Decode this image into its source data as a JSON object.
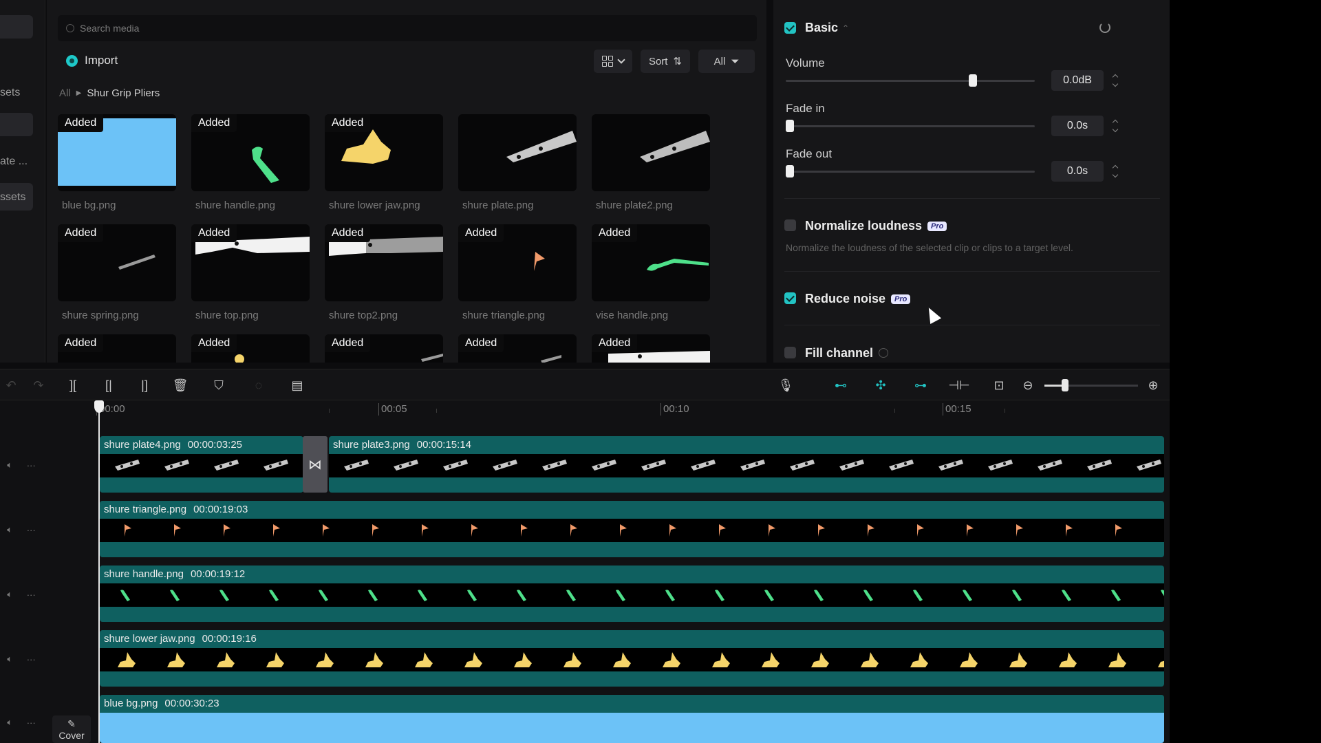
{
  "left_strip": {
    "items": [
      {
        "label": "sets"
      },
      {
        "label": "ate ..."
      },
      {
        "label": "ssets"
      }
    ]
  },
  "media": {
    "search_placeholder": "Search media",
    "import_label": "Import",
    "sort_label": "Sort",
    "filter_label": "All",
    "breadcrumb": {
      "root": "All",
      "current": "Shur Grip Pliers"
    },
    "tiles": [
      {
        "status": "Added",
        "name": "blue bg.png"
      },
      {
        "status": "Added",
        "name": "shure handle.png"
      },
      {
        "status": "Added",
        "name": "shure lower jaw.png"
      },
      {
        "status": "Added",
        "name": "shure plate.png"
      },
      {
        "status": "Added",
        "name": "shure plate2.png"
      },
      {
        "status": "Added",
        "name": "shure spring.png"
      },
      {
        "status": "Added",
        "name": "shure top.png"
      },
      {
        "status": "Added",
        "name": "shure top2.png"
      },
      {
        "status": "Added",
        "name": "shure triangle.png"
      },
      {
        "status": "Added",
        "name": "vise handle.png"
      },
      {
        "status": "Added",
        "name": ""
      },
      {
        "status": "Added",
        "name": ""
      },
      {
        "status": "Added",
        "name": ""
      },
      {
        "status": "Added",
        "name": ""
      },
      {
        "status": "Added",
        "name": ""
      }
    ]
  },
  "props": {
    "basic": {
      "title": "Basic",
      "checked": true
    },
    "volume": {
      "label": "Volume",
      "value": "0.0dB",
      "level": 0.75
    },
    "fade_in": {
      "label": "Fade in",
      "value": "0.0s",
      "level": 0
    },
    "fade_out": {
      "label": "Fade out",
      "value": "0.0s",
      "level": 0
    },
    "normalize": {
      "label": "Normalize loudness",
      "badge": "Pro",
      "checked": false,
      "description": "Normalize the loudness of the selected clip or clips to a target level."
    },
    "reduce_noise": {
      "label": "Reduce noise",
      "badge": "Pro",
      "checked": true
    },
    "fill_channel": {
      "label": "Fill channel",
      "checked": false
    }
  },
  "timeline": {
    "ruler": [
      "00:00",
      "00:05",
      "00:10",
      "00:15"
    ],
    "tracks": [
      {
        "clips": [
          {
            "name": "shure plate4.png",
            "duration": "00:00:03:25"
          },
          {
            "name": "shure plate3.png",
            "duration": "00:00:15:14"
          }
        ]
      },
      {
        "clips": [
          {
            "name": "shure triangle.png",
            "duration": "00:00:19:03"
          }
        ]
      },
      {
        "clips": [
          {
            "name": "shure handle.png",
            "duration": "00:00:19:12"
          }
        ]
      },
      {
        "clips": [
          {
            "name": "shure lower jaw.png",
            "duration": "00:00:19:16"
          }
        ]
      },
      {
        "clips": [
          {
            "name": "blue bg.png",
            "duration": "00:00:30:23"
          }
        ]
      }
    ],
    "cover_label": "Cover",
    "zoom_level": 0.22
  },
  "colors": {
    "accent": "#22c3c3",
    "clip_teal": "#0f6060",
    "bg_blue": "#6cc2f7",
    "triangle": "#f19a6a",
    "handle": "#4ee08a",
    "jaw": "#f5d46a",
    "plate": "#c8c8c8"
  }
}
